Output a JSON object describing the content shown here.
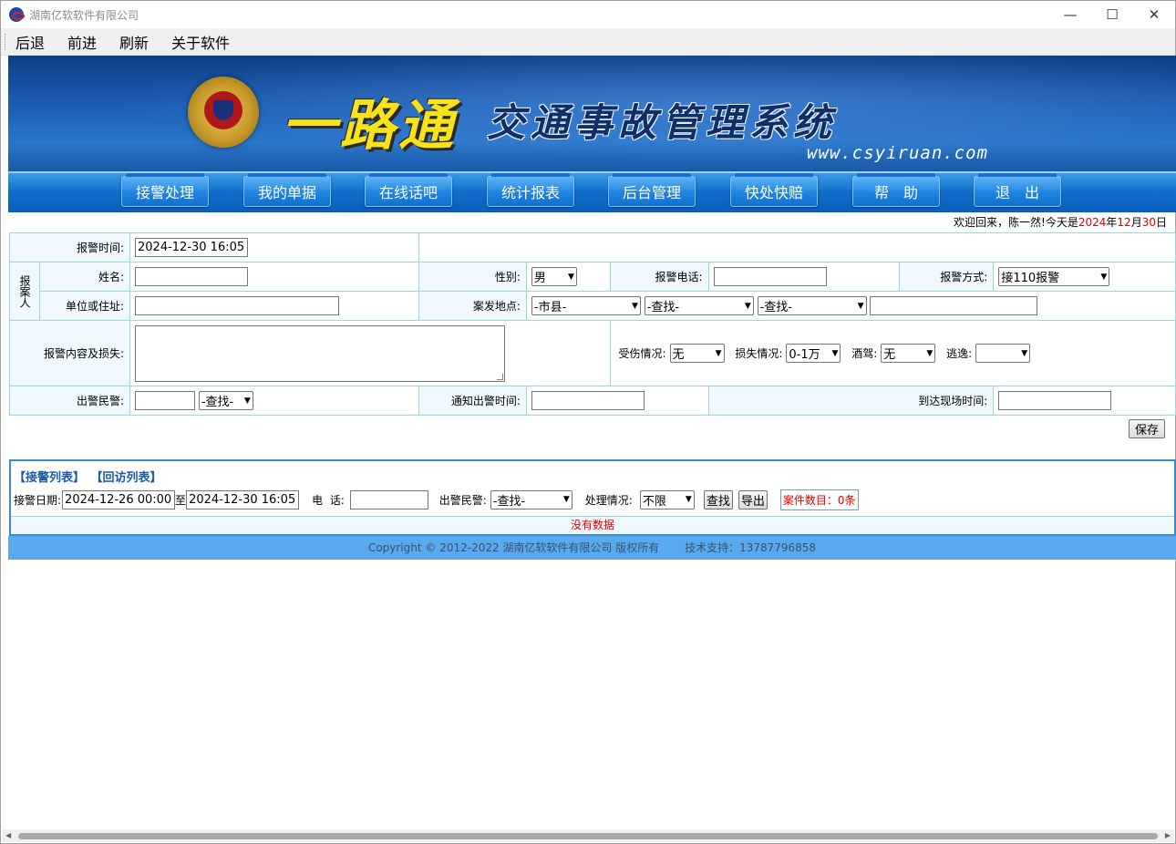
{
  "window": {
    "title": "湖南亿软软件有限公司",
    "minimize": "—",
    "maximize": "☐",
    "close": "✕"
  },
  "menu": [
    "后退",
    "前进",
    "刷新",
    "关于软件"
  ],
  "banner": {
    "main": "一路通",
    "sub": "交通事故管理系统",
    "url": "www.csyiruan.com"
  },
  "nav": [
    "接警处理",
    "我的单据",
    "在线话吧",
    "统计报表",
    "后台管理",
    "快处快赔",
    "帮　助",
    "退　出"
  ],
  "welcome": {
    "prefix": "欢迎回来，陈一然!今天是",
    "year": "2024",
    "y": "年",
    "month": "12",
    "m": "月",
    "day": "30",
    "d": "日"
  },
  "form": {
    "report_time_label": "报警时间:",
    "report_time_value": "2024-12-30 16:05",
    "reporter_group": "报案人",
    "name_label": "姓名:",
    "gender_label": "性别:",
    "gender_value": "男",
    "phone_label": "报警电话:",
    "method_label": "报警方式:",
    "method_value": "接110报警",
    "unit_label": "单位或住址:",
    "location_label": "案发地点:",
    "city_value": "-市县-",
    "find1_value": "-查找-",
    "find2_value": "-查找-",
    "content_label": "报警内容及损失:",
    "injury_label": "受伤情况:",
    "injury_value": "无",
    "loss_label": "损失情况:",
    "loss_value": "0-1万",
    "drunk_label": "酒驾:",
    "drunk_value": "无",
    "escape_label": "逃逸:",
    "escape_value": "",
    "police_label": "出警民警:",
    "police_find": "-查找-",
    "notify_label": "通知出警时间:",
    "arrive_label": "到达现场时间:",
    "save": "保存"
  },
  "list": {
    "tab1": "【接警列表】",
    "tab2": "【回访列表】",
    "date_label": "接警日期:",
    "date_from": "2024-12-26 00:00",
    "to": "至",
    "date_to": "2024-12-30 16:05",
    "phone_label": "电  话:",
    "police_label": "出警民警:",
    "police_value": "-查找-",
    "status_label": "处理情况:",
    "status_value": "不限",
    "search": "查找",
    "export": "导出",
    "count": "案件数目：0条",
    "nodata": "没有数据"
  },
  "footer": {
    "copyright": "Copyright © 2012-2022 湖南亿软软件有限公司 版权所有",
    "support": "技术支持：13787796858"
  }
}
